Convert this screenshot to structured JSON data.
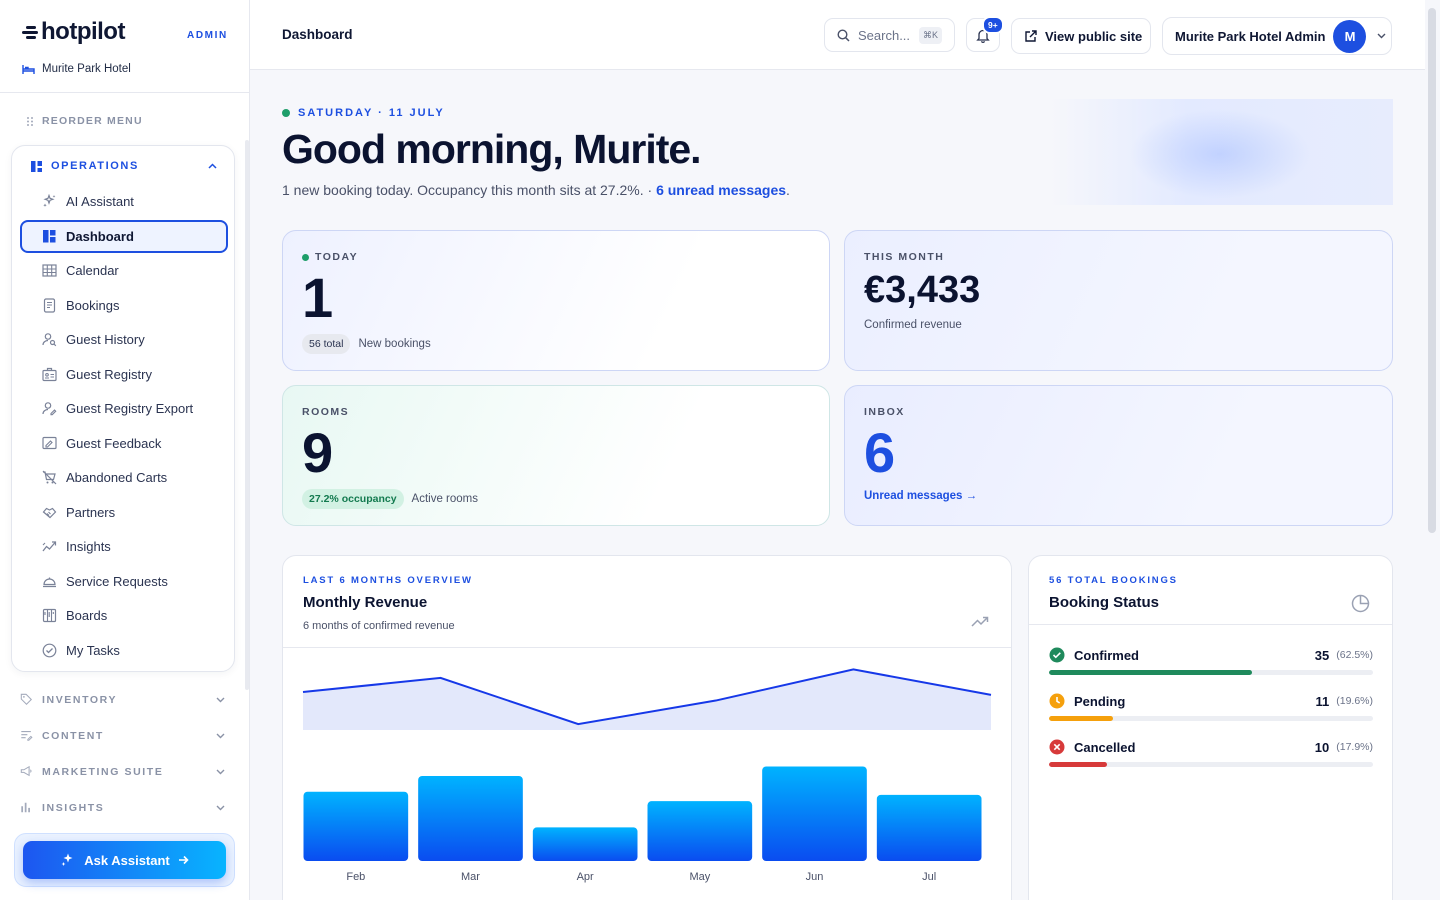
{
  "brand": {
    "name": "hotpilot",
    "tag": "ADMIN",
    "hotel": "Murite Park Hotel"
  },
  "sidebar": {
    "reorder_label": "REORDER MENU",
    "operations_label": "OPERATIONS",
    "items": [
      {
        "label": "AI Assistant",
        "icon": "sparkles-icon"
      },
      {
        "label": "Dashboard",
        "icon": "dashboard-icon",
        "active": true
      },
      {
        "label": "Calendar",
        "icon": "calendar-icon"
      },
      {
        "label": "Bookings",
        "icon": "document-icon"
      },
      {
        "label": "Guest History",
        "icon": "user-search-icon"
      },
      {
        "label": "Guest Registry",
        "icon": "registry-icon"
      },
      {
        "label": "Guest Registry Export",
        "icon": "user-export-icon"
      },
      {
        "label": "Guest Feedback",
        "icon": "feedback-icon"
      },
      {
        "label": "Abandoned Carts",
        "icon": "cart-off-icon"
      },
      {
        "label": "Partners",
        "icon": "handshake-icon"
      },
      {
        "label": "Insights",
        "icon": "trend-icon"
      },
      {
        "label": "Service Requests",
        "icon": "bell-service-icon"
      },
      {
        "label": "Boards",
        "icon": "board-icon"
      },
      {
        "label": "My Tasks",
        "icon": "check-circle-icon"
      }
    ],
    "groups": [
      {
        "label": "INVENTORY",
        "icon": "tag-icon"
      },
      {
        "label": "CONTENT",
        "icon": "content-icon"
      },
      {
        "label": "MARKETING SUITE",
        "icon": "megaphone-icon"
      },
      {
        "label": "INSIGHTS",
        "icon": "bar-chart-icon"
      }
    ],
    "ask_label": "Ask Assistant"
  },
  "topbar": {
    "title": "Dashboard",
    "search_placeholder": "Search...",
    "search_shortcut": "⌘K",
    "notif_badge": "9+",
    "view_site_label": "View public site",
    "user_label": "Murite Park Hotel Admin",
    "avatar_initial": "M"
  },
  "hero": {
    "date": "SATURDAY · 11 JULY",
    "greeting": "Good morning, Murite.",
    "summary": "1 new booking today. Occupancy this month sits at 27.2%. · ",
    "unread_link": "6 unread messages",
    "summary_end": "."
  },
  "stats": {
    "today": {
      "label": "TODAY",
      "value": "1",
      "pill": "56 total",
      "caption": "New bookings"
    },
    "month": {
      "label": "THIS MONTH",
      "value": "€3,433",
      "caption": "Confirmed revenue"
    },
    "rooms": {
      "label": "ROOMS",
      "value": "9",
      "pill": "27.2% occupancy",
      "caption": "Active rooms"
    },
    "inbox": {
      "label": "INBOX",
      "value": "6",
      "link": "Unread messages →"
    }
  },
  "revenue": {
    "kicker": "LAST 6 MONTHS OVERVIEW",
    "title": "Monthly Revenue",
    "subtitle": "6 months of confirmed revenue"
  },
  "chart_data": {
    "type": "bar",
    "categories": [
      "Feb",
      "Mar",
      "Apr",
      "May",
      "Jun",
      "Jul"
    ],
    "values": [
      660,
      810,
      320,
      570,
      900,
      630
    ],
    "ylim": [
      0,
      1000
    ],
    "grid": false,
    "colors": {
      "bar_top": "#00b3ff",
      "bar_bottom": "#0a4cf0",
      "line": "#1638e8",
      "area": "#e3e8fb"
    }
  },
  "booking_status": {
    "kicker": "56 TOTAL BOOKINGS",
    "title": "Booking Status",
    "rows": [
      {
        "name": "Confirmed",
        "count": "35",
        "pct": "(62.5%)",
        "fraction": 0.625,
        "color": "#1f8a5c",
        "icon": "check-circle-icon"
      },
      {
        "name": "Pending",
        "count": "11",
        "pct": "(19.6%)",
        "fraction": 0.196,
        "color": "#f5a00c",
        "icon": "clock-icon"
      },
      {
        "name": "Cancelled",
        "count": "10",
        "pct": "(17.9%)",
        "fraction": 0.179,
        "color": "#d73a3a",
        "icon": "x-circle-icon"
      }
    ]
  }
}
